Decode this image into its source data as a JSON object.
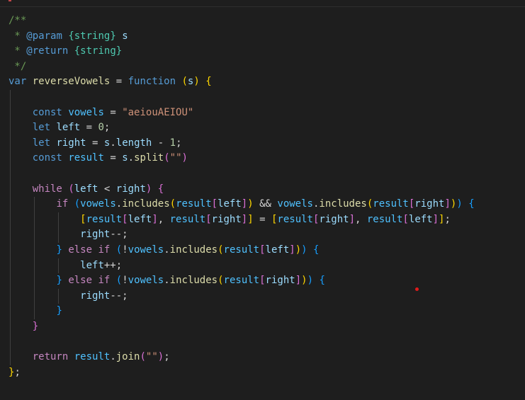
{
  "editor": {
    "language": "javascript",
    "code_lines": [
      [
        {
          "t": "/**",
          "c": "comment"
        }
      ],
      [
        {
          "t": " * ",
          "c": "comment"
        },
        {
          "t": "@param",
          "c": "jsdoc"
        },
        {
          "t": " ",
          "c": "comment"
        },
        {
          "t": "{string}",
          "c": "type"
        },
        {
          "t": " ",
          "c": "comment"
        },
        {
          "t": "s",
          "c": "variable"
        }
      ],
      [
        {
          "t": " * ",
          "c": "comment"
        },
        {
          "t": "@return",
          "c": "jsdoc"
        },
        {
          "t": " ",
          "c": "comment"
        },
        {
          "t": "{string}",
          "c": "type"
        }
      ],
      [
        {
          "t": " */",
          "c": "comment"
        }
      ],
      [
        {
          "t": "var",
          "c": "keyword"
        },
        {
          "t": " ",
          "c": "punct"
        },
        {
          "t": "reverseVowels",
          "c": "function"
        },
        {
          "t": " = ",
          "c": "punct"
        },
        {
          "t": "function",
          "c": "keyword"
        },
        {
          "t": " ",
          "c": "punct"
        },
        {
          "t": "(",
          "c": "bracket1"
        },
        {
          "t": "s",
          "c": "variable"
        },
        {
          "t": ")",
          "c": "bracket1"
        },
        {
          "t": " ",
          "c": "punct"
        },
        {
          "t": "{",
          "c": "bracket1"
        }
      ],
      [],
      [
        {
          "t": "    ",
          "c": "punct"
        },
        {
          "t": "const",
          "c": "keyword"
        },
        {
          "t": " ",
          "c": "punct"
        },
        {
          "t": "vowels",
          "c": "const"
        },
        {
          "t": " = ",
          "c": "punct"
        },
        {
          "t": "\"aeiouAEIOU\"",
          "c": "string"
        }
      ],
      [
        {
          "t": "    ",
          "c": "punct"
        },
        {
          "t": "let",
          "c": "keyword"
        },
        {
          "t": " ",
          "c": "punct"
        },
        {
          "t": "left",
          "c": "variable"
        },
        {
          "t": " = ",
          "c": "punct"
        },
        {
          "t": "0",
          "c": "number"
        },
        {
          "t": ";",
          "c": "punct"
        }
      ],
      [
        {
          "t": "    ",
          "c": "punct"
        },
        {
          "t": "let",
          "c": "keyword"
        },
        {
          "t": " ",
          "c": "punct"
        },
        {
          "t": "right",
          "c": "variable"
        },
        {
          "t": " = ",
          "c": "punct"
        },
        {
          "t": "s",
          "c": "variable"
        },
        {
          "t": ".",
          "c": "punct"
        },
        {
          "t": "length",
          "c": "variable"
        },
        {
          "t": " - ",
          "c": "punct"
        },
        {
          "t": "1",
          "c": "number"
        },
        {
          "t": ";",
          "c": "punct"
        }
      ],
      [
        {
          "t": "    ",
          "c": "punct"
        },
        {
          "t": "const",
          "c": "keyword"
        },
        {
          "t": " ",
          "c": "punct"
        },
        {
          "t": "result",
          "c": "const"
        },
        {
          "t": " = ",
          "c": "punct"
        },
        {
          "t": "s",
          "c": "variable"
        },
        {
          "t": ".",
          "c": "punct"
        },
        {
          "t": "split",
          "c": "function"
        },
        {
          "t": "(",
          "c": "bracket2"
        },
        {
          "t": "\"\"",
          "c": "string"
        },
        {
          "t": ")",
          "c": "bracket2"
        }
      ],
      [],
      [
        {
          "t": "    ",
          "c": "punct"
        },
        {
          "t": "while",
          "c": "control"
        },
        {
          "t": " ",
          "c": "punct"
        },
        {
          "t": "(",
          "c": "bracket2"
        },
        {
          "t": "left",
          "c": "variable"
        },
        {
          "t": " < ",
          "c": "punct"
        },
        {
          "t": "right",
          "c": "variable"
        },
        {
          "t": ")",
          "c": "bracket2"
        },
        {
          "t": " ",
          "c": "punct"
        },
        {
          "t": "{",
          "c": "bracket2"
        }
      ],
      [
        {
          "t": "        ",
          "c": "punct"
        },
        {
          "t": "if",
          "c": "control"
        },
        {
          "t": " ",
          "c": "punct"
        },
        {
          "t": "(",
          "c": "bracket3"
        },
        {
          "t": "vowels",
          "c": "const"
        },
        {
          "t": ".",
          "c": "punct"
        },
        {
          "t": "includes",
          "c": "function"
        },
        {
          "t": "(",
          "c": "bracket1"
        },
        {
          "t": "result",
          "c": "const"
        },
        {
          "t": "[",
          "c": "bracket2"
        },
        {
          "t": "left",
          "c": "variable"
        },
        {
          "t": "]",
          "c": "bracket2"
        },
        {
          "t": ")",
          "c": "bracket1"
        },
        {
          "t": " && ",
          "c": "punct"
        },
        {
          "t": "vowels",
          "c": "const"
        },
        {
          "t": ".",
          "c": "punct"
        },
        {
          "t": "includes",
          "c": "function"
        },
        {
          "t": "(",
          "c": "bracket1"
        },
        {
          "t": "result",
          "c": "const"
        },
        {
          "t": "[",
          "c": "bracket2"
        },
        {
          "t": "right",
          "c": "variable"
        },
        {
          "t": "]",
          "c": "bracket2"
        },
        {
          "t": ")",
          "c": "bracket1"
        },
        {
          "t": ")",
          "c": "bracket3"
        },
        {
          "t": " ",
          "c": "punct"
        },
        {
          "t": "{",
          "c": "bracket3"
        }
      ],
      [
        {
          "t": "            ",
          "c": "punct"
        },
        {
          "t": "[",
          "c": "bracket1"
        },
        {
          "t": "result",
          "c": "const"
        },
        {
          "t": "[",
          "c": "bracket2"
        },
        {
          "t": "left",
          "c": "variable"
        },
        {
          "t": "]",
          "c": "bracket2"
        },
        {
          "t": ", ",
          "c": "punct"
        },
        {
          "t": "result",
          "c": "const"
        },
        {
          "t": "[",
          "c": "bracket2"
        },
        {
          "t": "right",
          "c": "variable"
        },
        {
          "t": "]",
          "c": "bracket2"
        },
        {
          "t": "]",
          "c": "bracket1"
        },
        {
          "t": " = ",
          "c": "punct"
        },
        {
          "t": "[",
          "c": "bracket1"
        },
        {
          "t": "result",
          "c": "const"
        },
        {
          "t": "[",
          "c": "bracket2"
        },
        {
          "t": "right",
          "c": "variable"
        },
        {
          "t": "]",
          "c": "bracket2"
        },
        {
          "t": ", ",
          "c": "punct"
        },
        {
          "t": "result",
          "c": "const"
        },
        {
          "t": "[",
          "c": "bracket2"
        },
        {
          "t": "left",
          "c": "variable"
        },
        {
          "t": "]",
          "c": "bracket2"
        },
        {
          "t": "]",
          "c": "bracket1"
        },
        {
          "t": ";",
          "c": "punct"
        }
      ],
      [
        {
          "t": "            ",
          "c": "punct"
        },
        {
          "t": "right",
          "c": "variable"
        },
        {
          "t": "--;",
          "c": "punct"
        }
      ],
      [
        {
          "t": "        ",
          "c": "punct"
        },
        {
          "t": "}",
          "c": "bracket3"
        },
        {
          "t": " ",
          "c": "punct"
        },
        {
          "t": "else",
          "c": "control"
        },
        {
          "t": " ",
          "c": "punct"
        },
        {
          "t": "if",
          "c": "control"
        },
        {
          "t": " ",
          "c": "punct"
        },
        {
          "t": "(",
          "c": "bracket3"
        },
        {
          "t": "!",
          "c": "punct"
        },
        {
          "t": "vowels",
          "c": "const"
        },
        {
          "t": ".",
          "c": "punct"
        },
        {
          "t": "includes",
          "c": "function"
        },
        {
          "t": "(",
          "c": "bracket1"
        },
        {
          "t": "result",
          "c": "const"
        },
        {
          "t": "[",
          "c": "bracket2"
        },
        {
          "t": "left",
          "c": "variable"
        },
        {
          "t": "]",
          "c": "bracket2"
        },
        {
          "t": ")",
          "c": "bracket1"
        },
        {
          "t": ")",
          "c": "bracket3"
        },
        {
          "t": " ",
          "c": "punct"
        },
        {
          "t": "{",
          "c": "bracket3"
        }
      ],
      [
        {
          "t": "            ",
          "c": "punct"
        },
        {
          "t": "left",
          "c": "variable"
        },
        {
          "t": "++;",
          "c": "punct"
        }
      ],
      [
        {
          "t": "        ",
          "c": "punct"
        },
        {
          "t": "}",
          "c": "bracket3"
        },
        {
          "t": " ",
          "c": "punct"
        },
        {
          "t": "else",
          "c": "control"
        },
        {
          "t": " ",
          "c": "punct"
        },
        {
          "t": "if",
          "c": "control"
        },
        {
          "t": " ",
          "c": "punct"
        },
        {
          "t": "(",
          "c": "bracket3"
        },
        {
          "t": "!",
          "c": "punct"
        },
        {
          "t": "vowels",
          "c": "const"
        },
        {
          "t": ".",
          "c": "punct"
        },
        {
          "t": "includes",
          "c": "function"
        },
        {
          "t": "(",
          "c": "bracket1"
        },
        {
          "t": "result",
          "c": "const"
        },
        {
          "t": "[",
          "c": "bracket2"
        },
        {
          "t": "right",
          "c": "variable"
        },
        {
          "t": "]",
          "c": "bracket2"
        },
        {
          "t": ")",
          "c": "bracket1"
        },
        {
          "t": ")",
          "c": "bracket3"
        },
        {
          "t": " ",
          "c": "punct"
        },
        {
          "t": "{",
          "c": "bracket3"
        }
      ],
      [
        {
          "t": "            ",
          "c": "punct"
        },
        {
          "t": "right",
          "c": "variable"
        },
        {
          "t": "--;",
          "c": "punct"
        }
      ],
      [
        {
          "t": "        ",
          "c": "punct"
        },
        {
          "t": "}",
          "c": "bracket3"
        }
      ],
      [
        {
          "t": "    ",
          "c": "punct"
        },
        {
          "t": "}",
          "c": "bracket2"
        }
      ],
      [],
      [
        {
          "t": "    ",
          "c": "punct"
        },
        {
          "t": "return",
          "c": "control"
        },
        {
          "t": " ",
          "c": "punct"
        },
        {
          "t": "result",
          "c": "const"
        },
        {
          "t": ".",
          "c": "punct"
        },
        {
          "t": "join",
          "c": "function"
        },
        {
          "t": "(",
          "c": "bracket2"
        },
        {
          "t": "\"\"",
          "c": "string"
        },
        {
          "t": ")",
          "c": "bracket2"
        },
        {
          "t": ";",
          "c": "punct"
        }
      ],
      [
        {
          "t": "}",
          "c": "bracket1"
        },
        {
          "t": ";",
          "c": "punct"
        }
      ]
    ]
  },
  "colors": {
    "background": "#1e1e1e",
    "indent_guide": "#404040",
    "cursor_dot": "#e01b1b"
  }
}
